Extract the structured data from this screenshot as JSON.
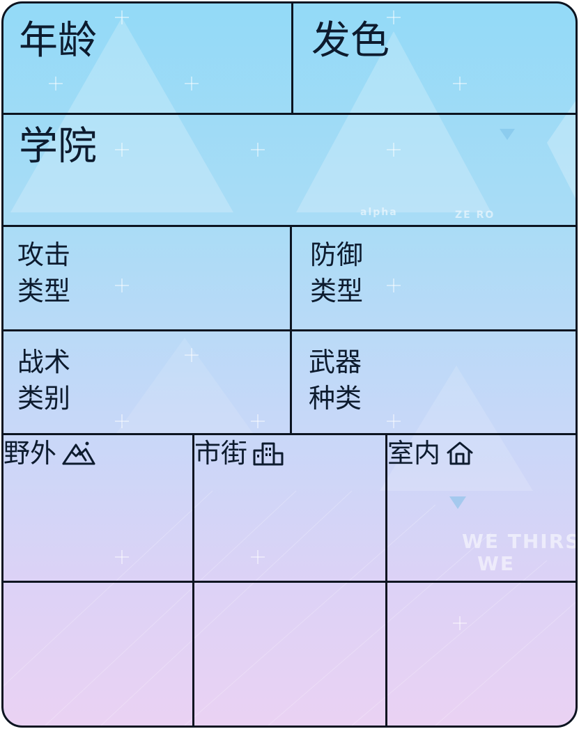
{
  "fields": {
    "age": "年龄",
    "hair_color": "发色",
    "academy": "学院",
    "attack_type_line1": "攻击",
    "attack_type_line2": "类型",
    "defense_type_line1": "防御",
    "defense_type_line2": "类型",
    "tactic_line1": "战术",
    "tactic_line2": "类别",
    "weapon_line1": "武器",
    "weapon_line2": "种类"
  },
  "environments": {
    "outdoor": "野外",
    "outdoor_icon": "mountain-icon",
    "street": "市街",
    "street_icon": "city-buildings-icon",
    "indoor": "室内",
    "indoor_icon": "house-icon"
  },
  "watermarks": {
    "line1": "WE THIRST",
    "line2": "WE",
    "small1": "alpha",
    "small2": "ZE RO"
  },
  "colors": {
    "border": "#0c1420",
    "top": "#93daf7",
    "bottom": "#ead2f3",
    "text": "#0d1b2e"
  }
}
